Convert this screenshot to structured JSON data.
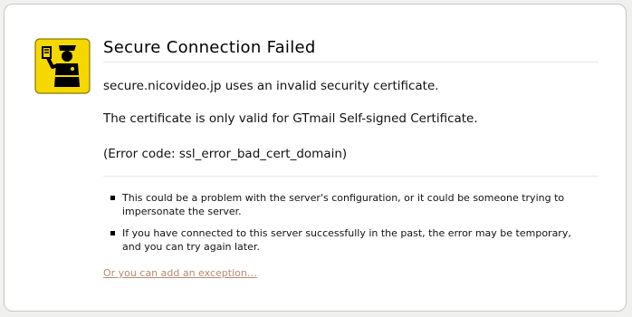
{
  "error": {
    "icon": "officer-badge-icon",
    "title": "Secure Connection Failed",
    "messages": [
      "secure.nicovideo.jp uses an invalid security certificate.",
      "The certificate is only valid for GTmail Self-signed Certificate.",
      "(Error code: ssl_error_bad_cert_domain)"
    ],
    "bullets": [
      "This could be a problem with the server's configuration, or it could be someone trying to impersonate the server.",
      "If you have connected to this server successfully in the past, the error may be temporary, and you can try again later."
    ],
    "exception_link": "Or you can add an exception…"
  },
  "colors": {
    "icon_yellow": "#f5d800",
    "link": "#b88970"
  }
}
